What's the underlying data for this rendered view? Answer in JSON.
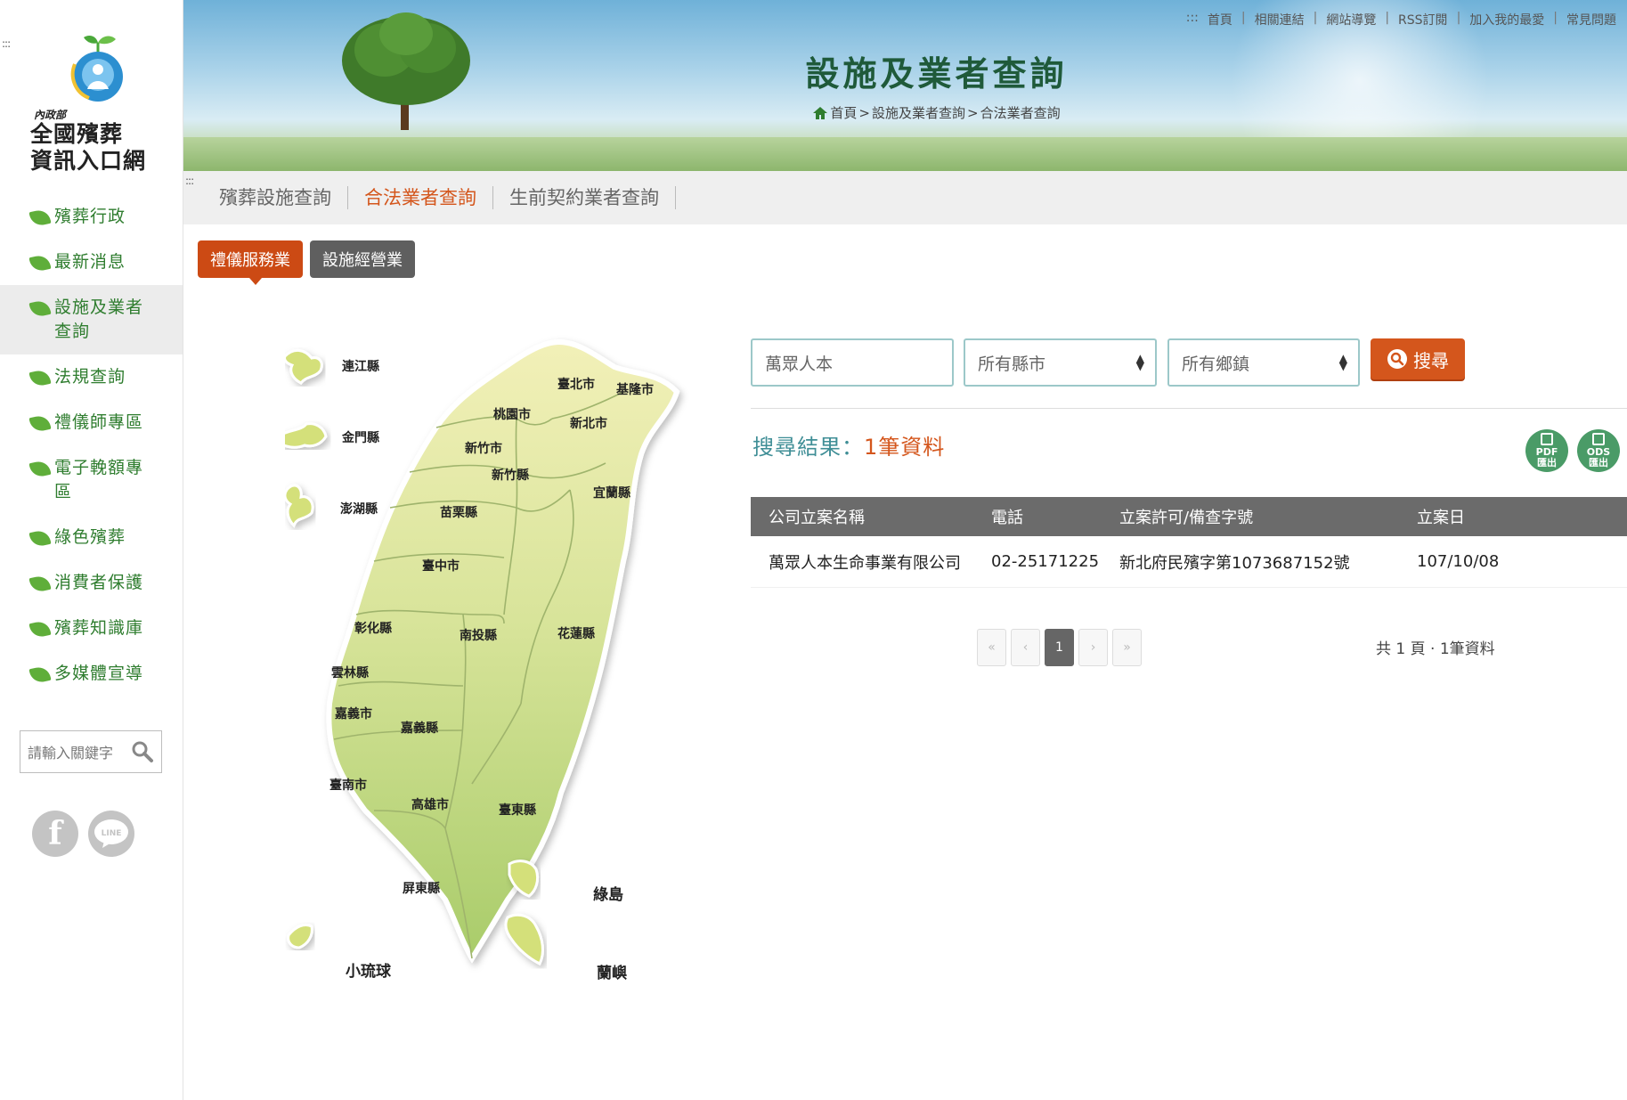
{
  "sidebar": {
    "accesskey": ":::",
    "logo": {
      "ministry": "內政部",
      "line1": "全國殯葬",
      "line2": "資訊入口網"
    },
    "nav": [
      {
        "label": "殯葬行政"
      },
      {
        "label": "最新消息"
      },
      {
        "label": "設施及業者查詢",
        "line1": "設施及業者",
        "line2": "查詢",
        "active": true
      },
      {
        "label": "法規查詢"
      },
      {
        "label": "禮儀師專區"
      },
      {
        "label": "電子輓額專區",
        "line1": "電子輓額專",
        "line2": "區"
      },
      {
        "label": "綠色殯葬"
      },
      {
        "label": "消費者保護"
      },
      {
        "label": "殯葬知識庫"
      },
      {
        "label": "多媒體宣導"
      }
    ],
    "search_placeholder": "請輸入關鍵字",
    "social": {
      "facebook": "f",
      "line": "LINE"
    }
  },
  "header": {
    "top_links": {
      "prefix": ":::",
      "items": [
        "首頁",
        "相關連結",
        "網站導覽",
        "RSS訂閱",
        "加入我的最愛",
        "常見問題"
      ],
      "separators": [
        "|",
        "|",
        "|",
        "|",
        "|"
      ]
    },
    "title": "設施及業者查詢",
    "breadcrumb": {
      "home": "首頁",
      "sep1": ">",
      "mid": "設施及業者查詢",
      "sep2": ">",
      "current": "合法業者查詢"
    }
  },
  "subnav": {
    "accesskey": ":::",
    "tabs": [
      {
        "label": "殯葬設施查詢"
      },
      {
        "label": "合法業者查詢",
        "active": true
      },
      {
        "label": "生前契約業者查詢"
      }
    ]
  },
  "type_buttons": {
    "active": "禮儀服務業",
    "other": "設施經營業"
  },
  "map": {
    "regions": [
      "連江縣",
      "金門縣",
      "澎湖縣",
      "臺北市",
      "基隆市",
      "桃園市",
      "新北市",
      "新竹市",
      "新竹縣",
      "宜蘭縣",
      "苗栗縣",
      "臺中市",
      "彰化縣",
      "南投縣",
      "花蓮縣",
      "雲林縣",
      "嘉義市",
      "嘉義縣",
      "臺南市",
      "高雄市",
      "臺東縣",
      "屏東縣",
      "綠島",
      "小琉球",
      "蘭嶼"
    ]
  },
  "search": {
    "keyword_value": "萬眾人本",
    "city_value": "所有縣市",
    "town_value": "所有鄉鎮",
    "button_label": "搜尋"
  },
  "results": {
    "label": "搜尋結果：",
    "count_text": "1筆資料",
    "export_pdf": {
      "line1": "PDF",
      "line2": "匯出"
    },
    "export_ods": {
      "line1": "ODS",
      "line2": "匯出"
    }
  },
  "table": {
    "headers": [
      "公司立案名稱",
      "電話",
      "立案許可/備查字號",
      "立案日"
    ],
    "rows": [
      [
        "萬眾人本生命事業有限公司",
        "02-25171225",
        "新北府民殯字第1073687152號",
        "107/10/08"
      ]
    ]
  },
  "pagination": {
    "first": "«",
    "prev": "‹",
    "current": "1",
    "next": "›",
    "last": "»",
    "summary": "共 1 頁 · 1筆資料"
  },
  "colors": {
    "accent": "#d4561c",
    "nav_green": "#2f7d2f",
    "header_gray": "#6b6b6b",
    "input_border": "#9cc8c9"
  }
}
